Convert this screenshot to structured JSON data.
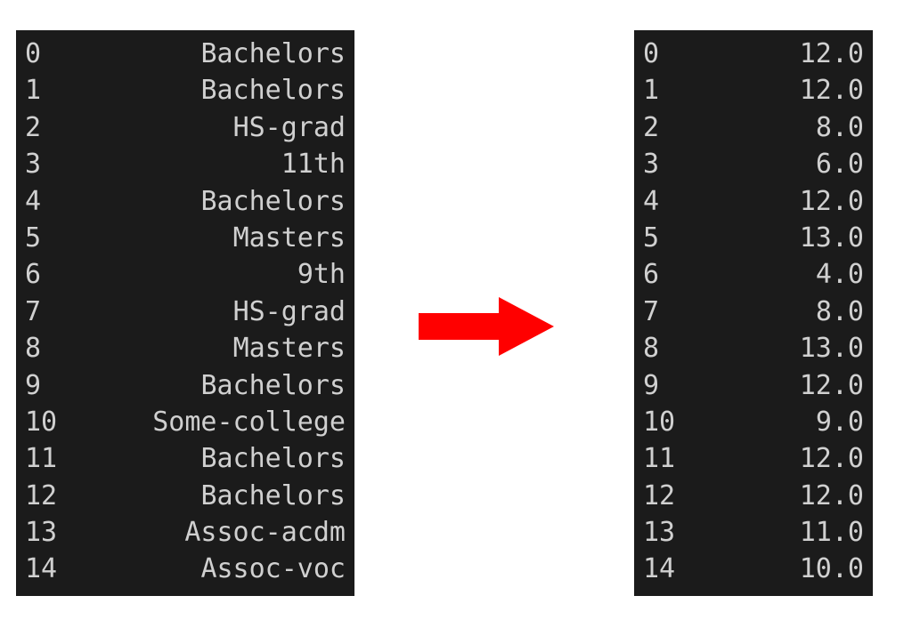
{
  "left_table": {
    "rows": [
      {
        "index": "0",
        "value": "Bachelors"
      },
      {
        "index": "1",
        "value": "Bachelors"
      },
      {
        "index": "2",
        "value": "HS-grad"
      },
      {
        "index": "3",
        "value": "11th"
      },
      {
        "index": "4",
        "value": "Bachelors"
      },
      {
        "index": "5",
        "value": "Masters"
      },
      {
        "index": "6",
        "value": "9th"
      },
      {
        "index": "7",
        "value": "HS-grad"
      },
      {
        "index": "8",
        "value": "Masters"
      },
      {
        "index": "9",
        "value": "Bachelors"
      },
      {
        "index": "10",
        "value": "Some-college"
      },
      {
        "index": "11",
        "value": "Bachelors"
      },
      {
        "index": "12",
        "value": "Bachelors"
      },
      {
        "index": "13",
        "value": "Assoc-acdm"
      },
      {
        "index": "14",
        "value": "Assoc-voc"
      }
    ]
  },
  "right_table": {
    "rows": [
      {
        "index": "0",
        "value": "12.0"
      },
      {
        "index": "1",
        "value": "12.0"
      },
      {
        "index": "2",
        "value": "8.0"
      },
      {
        "index": "3",
        "value": "6.0"
      },
      {
        "index": "4",
        "value": "12.0"
      },
      {
        "index": "5",
        "value": "13.0"
      },
      {
        "index": "6",
        "value": "4.0"
      },
      {
        "index": "7",
        "value": "8.0"
      },
      {
        "index": "8",
        "value": "13.0"
      },
      {
        "index": "9",
        "value": "12.0"
      },
      {
        "index": "10",
        "value": "9.0"
      },
      {
        "index": "11",
        "value": "12.0"
      },
      {
        "index": "12",
        "value": "12.0"
      },
      {
        "index": "13",
        "value": "11.0"
      },
      {
        "index": "14",
        "value": "10.0"
      }
    ]
  },
  "arrow": {
    "color": "#ff0000"
  }
}
